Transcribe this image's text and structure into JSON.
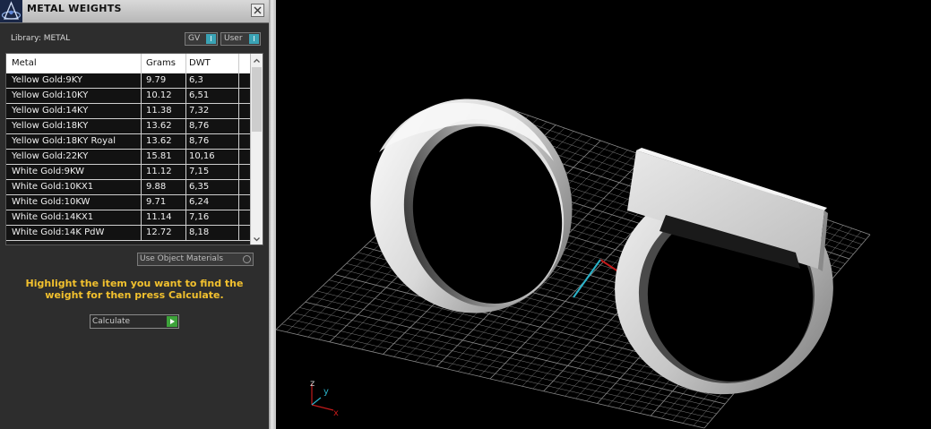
{
  "panel": {
    "title": "METAL WEIGHTS",
    "library_label": "Library: METAL",
    "toggles": {
      "gv": "GV",
      "user": "User",
      "toggle_glyph": "I"
    },
    "table": {
      "headers": [
        "Metal",
        "Grams",
        "DWT"
      ],
      "rows": [
        {
          "metal": "Yellow Gold:9KY",
          "grams": "9.79",
          "dwt": "6,3"
        },
        {
          "metal": "Yellow Gold:10KY",
          "grams": "10.12",
          "dwt": "6,51"
        },
        {
          "metal": "Yellow Gold:14KY",
          "grams": "11.38",
          "dwt": "7,32"
        },
        {
          "metal": "Yellow Gold:18KY",
          "grams": "13.62",
          "dwt": "8,76"
        },
        {
          "metal": "Yellow Gold:18KY Royal",
          "grams": "13.62",
          "dwt": "8,76"
        },
        {
          "metal": "Yellow Gold:22KY",
          "grams": "15.81",
          "dwt": "10,16"
        },
        {
          "metal": "White Gold:9KW",
          "grams": "11.12",
          "dwt": "7,15"
        },
        {
          "metal": "White Gold:10KX1",
          "grams": "9.88",
          "dwt": "6,35"
        },
        {
          "metal": "White Gold:10KW",
          "grams": "9.71",
          "dwt": "6,24"
        },
        {
          "metal": "White Gold:14KX1",
          "grams": "11.14",
          "dwt": "7,16"
        },
        {
          "metal": "White Gold:14K PdW",
          "grams": "12.72",
          "dwt": "8,18"
        }
      ]
    },
    "use_object_materials": "Use Object Materials",
    "hint": "Highlight the item you want to find the weight for then press Calculate.",
    "calculate": "Calculate"
  },
  "viewport": {
    "axis_labels": {
      "z": "z",
      "y": "y",
      "x": "x"
    },
    "colors": {
      "x_axis": "#c21a1a",
      "y_axis": "#2bb3c9",
      "z_axis": "#c21a1a",
      "grid": "#8a8a8a"
    }
  }
}
